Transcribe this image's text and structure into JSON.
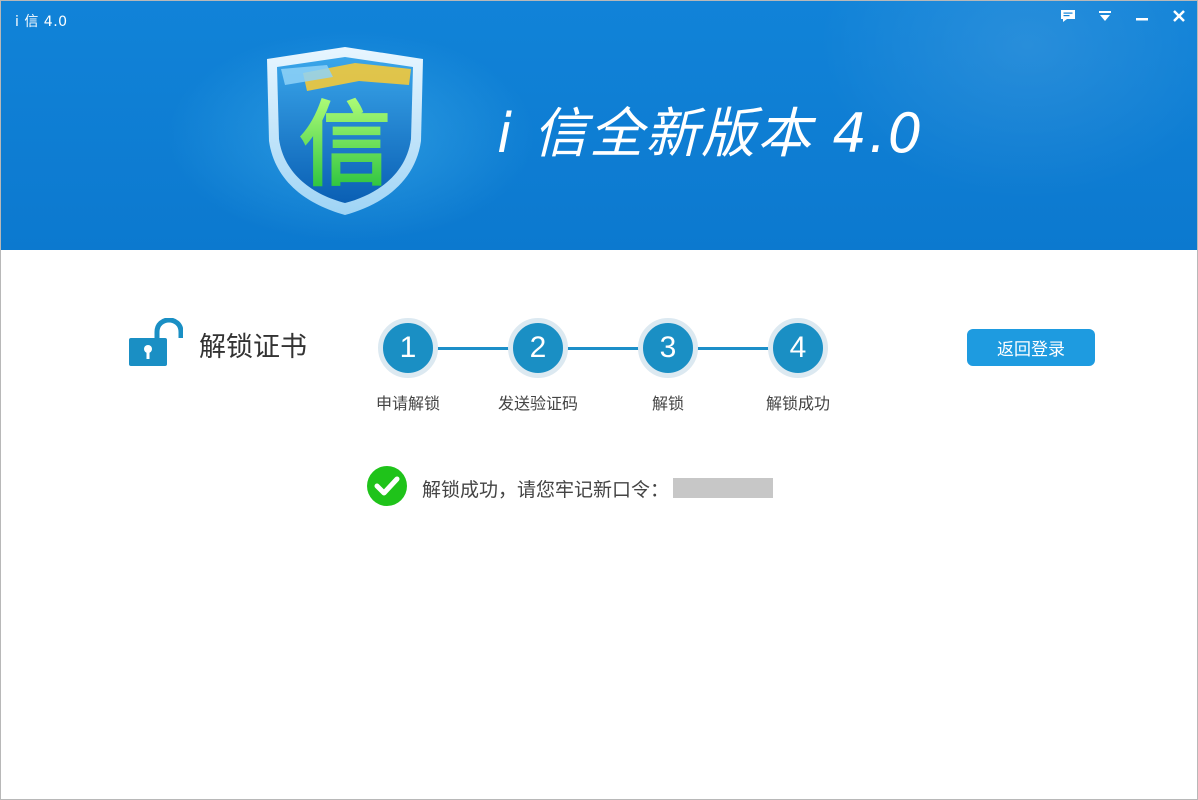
{
  "window": {
    "title": "i 信 4.0",
    "controls": [
      {
        "name": "feedback-icon"
      },
      {
        "name": "menu-dropdown-icon"
      },
      {
        "name": "minimize-icon"
      },
      {
        "name": "close-icon"
      }
    ]
  },
  "banner": {
    "logo_char": "信",
    "title": "i 信全新版本 4.0"
  },
  "section": {
    "icon": "unlock-icon",
    "title": "解锁证书"
  },
  "steps": [
    {
      "number": "1",
      "label": "申请解锁"
    },
    {
      "number": "2",
      "label": "发送验证码"
    },
    {
      "number": "3",
      "label": "解锁"
    },
    {
      "number": "4",
      "label": "解锁成功"
    }
  ],
  "actions": {
    "back_label": "返回登录"
  },
  "result": {
    "icon": "check-circle-icon",
    "message": "解锁成功，请您牢记新口令："
  },
  "colors": {
    "banner": "#0c79cf",
    "step": "#1a8fc4",
    "button": "#1e9be0",
    "success": "#1fc31a"
  }
}
